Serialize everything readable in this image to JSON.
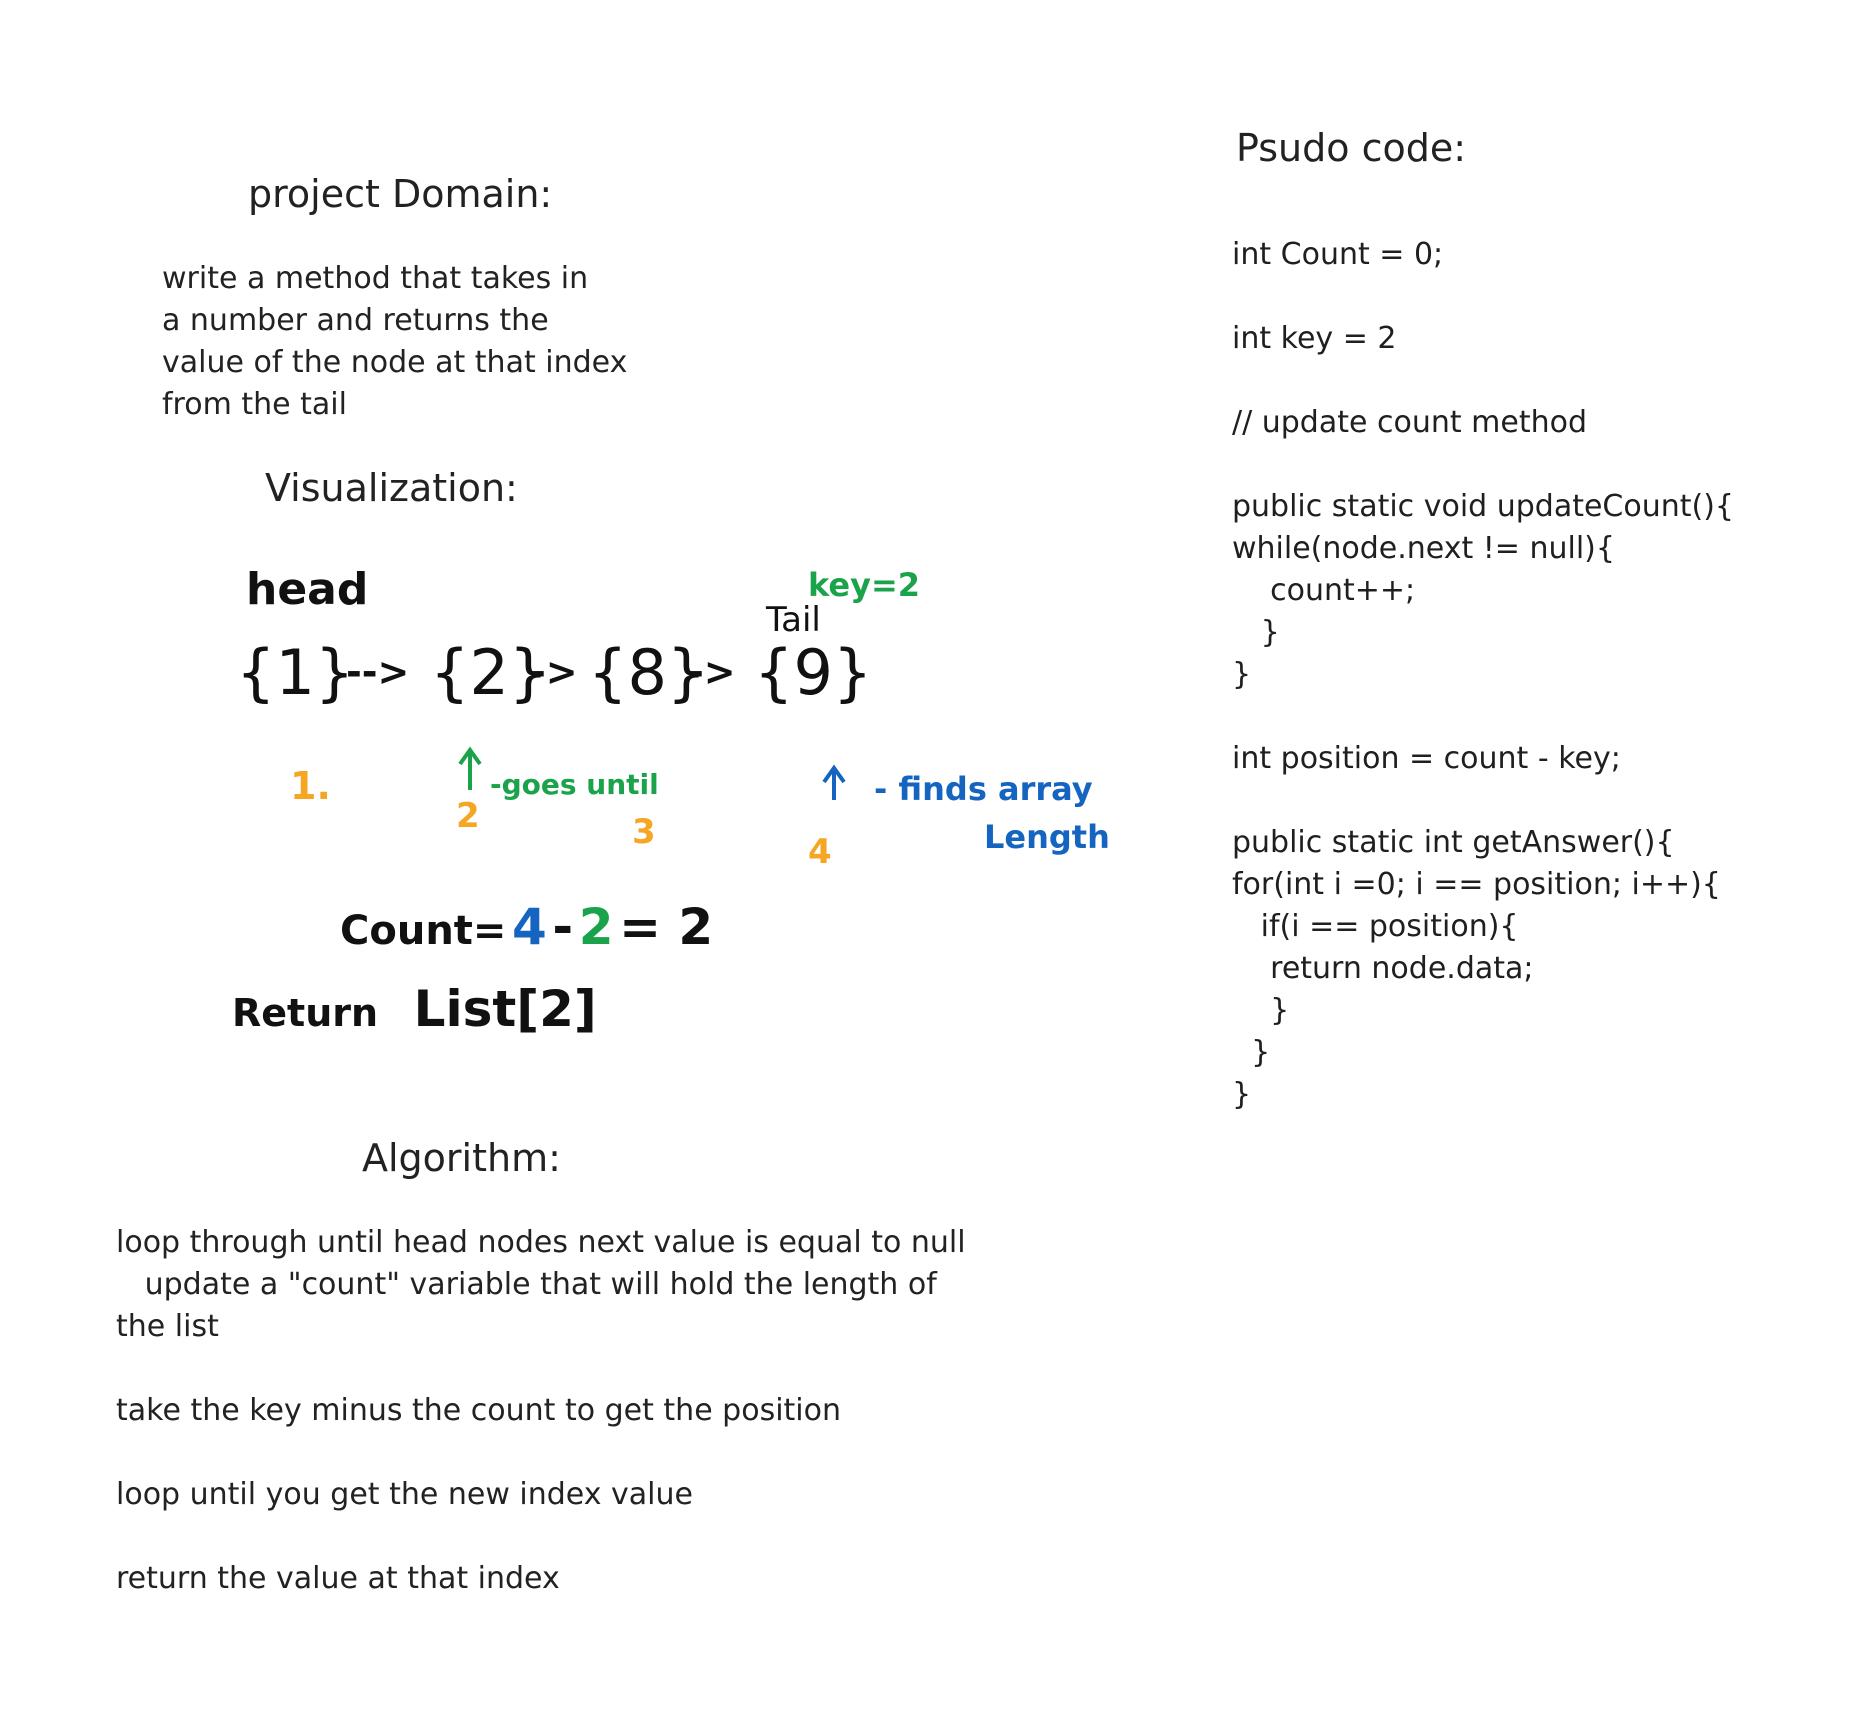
{
  "project_domain": {
    "title": "project Domain:",
    "lines": [
      "write a method that takes in",
      "a number and returns the",
      "value of the node at that index",
      "from the tail"
    ]
  },
  "visualization": {
    "title": "Visualization:",
    "head_label": "head",
    "tail_label": "Tail",
    "key_note": "key=2",
    "nodes": [
      "{1}",
      "{2}",
      "{8}",
      "{9}"
    ],
    "arrows": [
      "-->",
      "->",
      "->"
    ],
    "step_numbers": [
      "1.",
      "2",
      "3",
      "4"
    ],
    "goes_until_note": "-goes until",
    "finds_note_line1": "- finds array",
    "finds_note_line2": "Length",
    "count_prefix": "Count=",
    "count_value": "4",
    "count_minus": "-",
    "count_key": "2",
    "count_result": "= 2",
    "return_label": "Return",
    "return_expr": "List[2]",
    "colors": {
      "orange": "#f5a623",
      "green": "#1aa34a",
      "blue": "#1565c0",
      "ink": "#111111"
    }
  },
  "algorithm": {
    "title": "Algorithm:",
    "lines": [
      "loop through until head nodes next value is equal to null",
      "   update a \"count\" variable that will hold the length of",
      "the list",
      "",
      "take the key minus the count to get the position",
      "",
      "loop until you get the new index value",
      "",
      "return the value at that index"
    ]
  },
  "pseudo_code": {
    "title": "Psudo code:",
    "lines": [
      "int Count = 0;",
      "",
      "int key = 2",
      "",
      "// update count method",
      "",
      "public static void updateCount(){",
      "while(node.next != null){",
      "    count++;",
      "   }",
      "}",
      "",
      "int position = count - key;",
      "",
      "public static int getAnswer(){",
      "for(int i =0; i == position; i++){",
      "   if(i == position){",
      "    return node.data;",
      "    }",
      "  }",
      "}"
    ]
  }
}
